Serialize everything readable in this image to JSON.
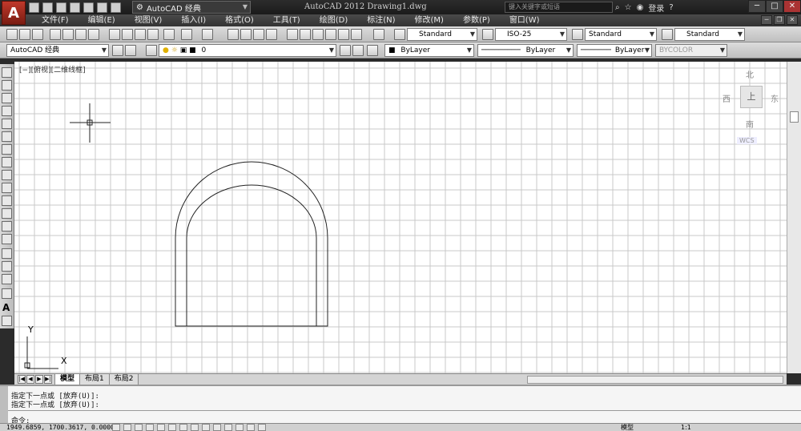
{
  "titlebar": {
    "workspace": "AutoCAD 经典",
    "title": "AutoCAD 2012    Drawing1.dwg",
    "search_placeholder": "键入关键字或短语",
    "login": "登录",
    "min": "─",
    "max": "□",
    "close": "✕"
  },
  "menu": {
    "items": [
      "文件(F)",
      "编辑(E)",
      "视图(V)",
      "插入(I)",
      "格式(O)",
      "工具(T)",
      "绘图(D)",
      "标注(N)",
      "修改(M)",
      "参数(P)",
      "窗口(W)"
    ]
  },
  "toolbar1": {
    "text_style": "Standard",
    "dim_style": "ISO-25",
    "table_style": "Standard",
    "mleader_style": "Standard"
  },
  "toolbar2": {
    "workspace": "AutoCAD 经典",
    "layer": "0",
    "color": "ByLayer",
    "linetype": "ByLayer",
    "lineweight": "ByLayer",
    "plotstyle": "BYCOLOR"
  },
  "viewport": {
    "label": "[−][俯视][二维线框]",
    "north": "北",
    "south": "南",
    "east": "东",
    "west": "西",
    "top": "上",
    "wcs": "WCS"
  },
  "ucs": {
    "x": "X",
    "y": "Y"
  },
  "tabs": [
    "模型",
    "布局1",
    "布局2"
  ],
  "command": {
    "line1": "指定下一点或 [放弃(U)]:",
    "line2": "指定下一点或 [放弃(U)]:",
    "prompt": "命令:"
  },
  "status": {
    "coords": "1949.6859, 1700.3617, 0.0000",
    "model": "模型",
    "scale": "1:1"
  },
  "lefttb": {
    "text_tool": "A"
  }
}
